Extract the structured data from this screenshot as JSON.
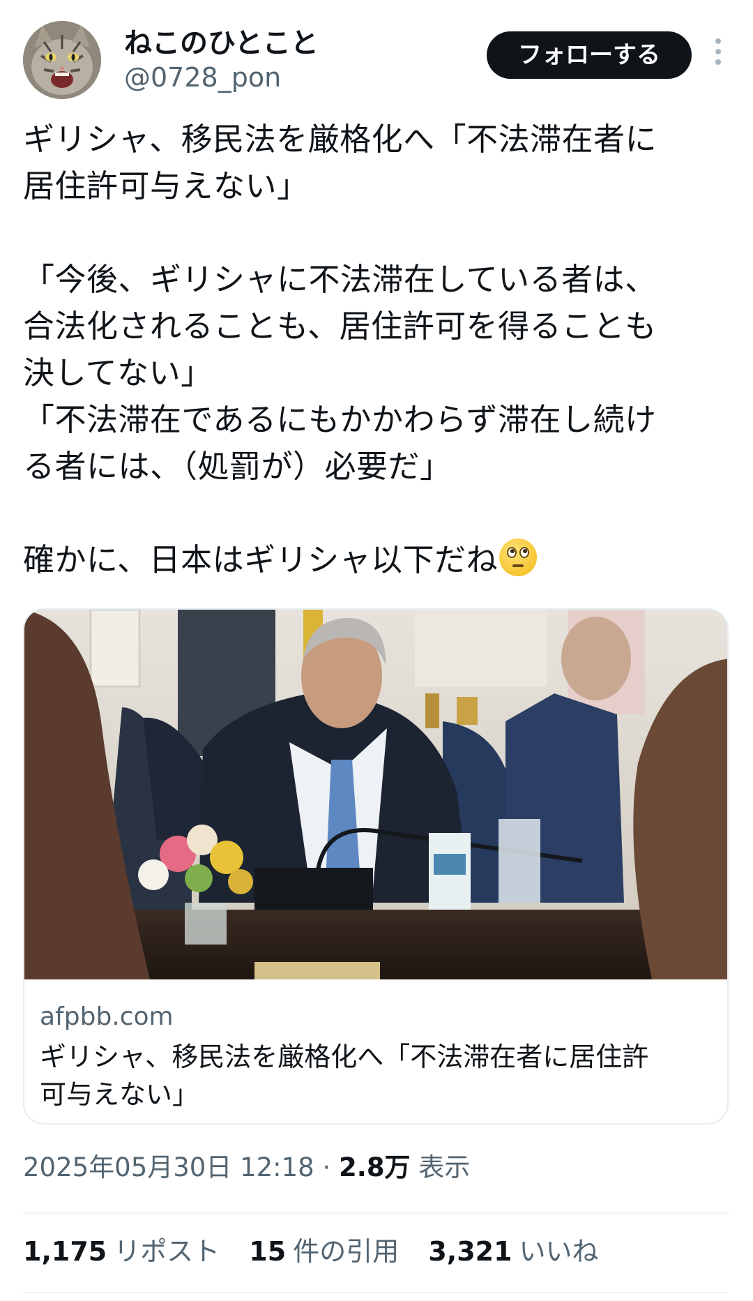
{
  "user": {
    "display_name": "ねこのひとこと",
    "handle": "@0728_pon",
    "avatar_icon": "cat-avatar-icon"
  },
  "actions": {
    "follow_label": "フォローする",
    "more_icon": "more-vertical-icon"
  },
  "tweet": {
    "lines": [
      "ギリシャ、移民法を厳格化へ「不法滞在者に",
      "居住許可与えない」",
      "",
      "「今後、ギリシャに不法滞在している者は、",
      "合法化されることも、居住許可を得ることも",
      "決してない」",
      "「不法滞在であるにもかかわらず滞在し続け",
      "る者には、（処罰が）必要だ」",
      "",
      "確かに、日本はギリシャ以下だね"
    ],
    "emoji": "face-with-rolling-eyes"
  },
  "link_card": {
    "domain": "afpbb.com",
    "title_line1": "ギリシャ、移民法を厳格化へ「不法滞在者に居住許",
    "title_line2": "可与えない」",
    "image_icon": "news-photo"
  },
  "meta": {
    "timestamp": "2025年05月30日 12:18",
    "separator": "·",
    "views_count": "2.8万",
    "views_label": "表示"
  },
  "stats": {
    "reposts_count": "1,175",
    "reposts_label": "リポスト",
    "quotes_count": "15",
    "quotes_label": "件の引用",
    "likes_count": "3,321",
    "likes_label": "いいね"
  },
  "colors": {
    "text": "#0f1419",
    "secondary": "#536471",
    "follow_bg": "#0f1419",
    "border": "#e6ecf0"
  }
}
